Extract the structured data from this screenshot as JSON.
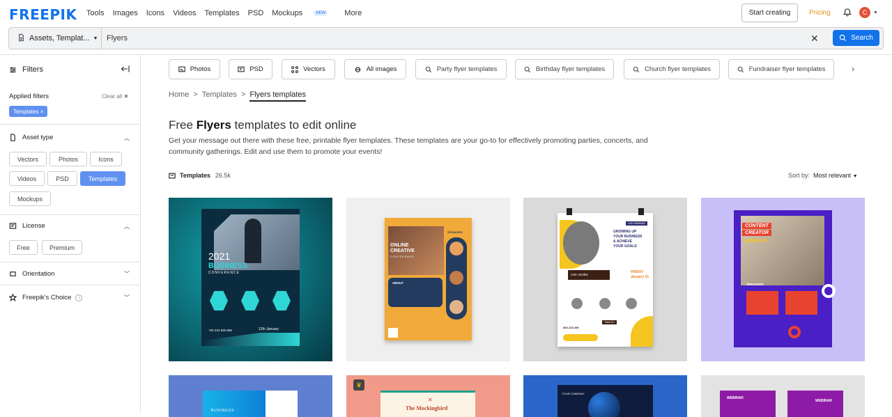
{
  "nav": {
    "logo": "FREEPIK",
    "links": [
      "Tools",
      "Images",
      "Icons",
      "Videos",
      "Templates",
      "PSD",
      "Mockups",
      "More"
    ],
    "new_badge": "NEW",
    "start_creating": "Start creating",
    "pricing": "Pricing",
    "avatar_letter": "C"
  },
  "search": {
    "type_label": "Assets, Templat...",
    "value": "Flyers",
    "button": "Search"
  },
  "sidebar": {
    "title": "Filters",
    "applied_label": "Applied filters",
    "clear_all": "Clear all",
    "applied_chip": "Templates",
    "asset_type": "Asset type",
    "asset_options": [
      "Vectors",
      "Photos",
      "Icons",
      "Videos",
      "PSD",
      "Templates",
      "Mockups"
    ],
    "license": "License",
    "license_options": [
      "Free",
      "Premium"
    ],
    "orientation": "Orientation",
    "choice": "Freepik's Choice"
  },
  "tags": {
    "types": [
      "Photos",
      "PSD",
      "Vectors",
      "All images"
    ],
    "suggestions": [
      "Party flyer templates",
      "Birthday flyer templates",
      "Church flyer templates",
      "Fundraiser flyer templates"
    ]
  },
  "breadcrumb": [
    "Home",
    "Templates",
    "Flyers templates"
  ],
  "heading": {
    "pre": "Free",
    "bold": "Flyers",
    "post": "templates to edit online"
  },
  "description": "Get your message out there with these free, printable flyer templates. These templates are your go-to for effectively promoting parties, concerts, and community gatherings. Edit and use them to promote your events!",
  "results": {
    "label": "Templates",
    "count": "26.5k",
    "sort_label": "Sort by:",
    "sort_value": "Most relevant"
  },
  "cards": {
    "c1": {
      "year": "2021",
      "title": "BUSINESS",
      "sub": "CONFERENCE",
      "date": "12th January",
      "phone": "+00 234 845 965"
    },
    "c2": {
      "title1": "ONLINE",
      "title2": "CREATIVE",
      "sub": "CONFERENCE",
      "about": "ABOUT",
      "speakers": "SPEAKERS"
    },
    "c3": {
      "badge": "LIVE WEBINAR",
      "h1": "GROWING UP",
      "h2": "YOUR BUSINESS",
      "h3": "& ACHIEVE",
      "h4": "YOUR GOALS",
      "speaker": "John Smiths",
      "day": "FRIDAY",
      "date": "January 21",
      "phone": "800-123-456",
      "ticket": "Ticket $ 0"
    },
    "c4": {
      "t1": "CONTENT",
      "t2": "CREATOR",
      "t3": "WEBINAR",
      "speakers": "SPEAKERS"
    },
    "c5": {
      "t": "BUSINESS"
    },
    "c6": {
      "t": "The Mockingbird"
    },
    "c7": {
      "t": "YOUR COMPANY"
    },
    "c8": {
      "t1": "WEBINAR",
      "t2": "WEBINAR"
    }
  }
}
